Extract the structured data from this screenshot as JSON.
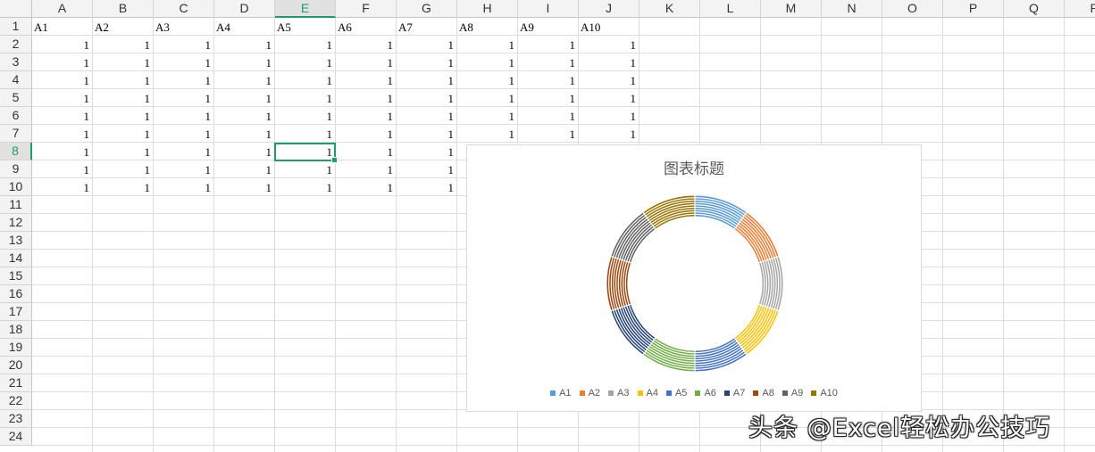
{
  "columns": [
    "A",
    "B",
    "C",
    "D",
    "E",
    "F",
    "G",
    "H",
    "I",
    "J",
    "K",
    "L",
    "M",
    "N",
    "O",
    "P",
    "Q",
    "R"
  ],
  "rows": [
    "1",
    "2",
    "3",
    "4",
    "5",
    "6",
    "7",
    "8",
    "9",
    "10",
    "11",
    "12",
    "13",
    "14",
    "15",
    "16",
    "17",
    "18",
    "19",
    "20",
    "21",
    "22",
    "23",
    "24"
  ],
  "selected_column": "E",
  "selected_row": "8",
  "header_row": [
    "A1",
    "A2",
    "A3",
    "A4",
    "A5",
    "A6",
    "A7",
    "A8",
    "A9",
    "A10"
  ],
  "cell_value": "1",
  "chart": {
    "title": "图表标题",
    "legend": [
      {
        "name": "A1",
        "color": "#5b9bd5"
      },
      {
        "name": "A2",
        "color": "#ed7d31"
      },
      {
        "name": "A3",
        "color": "#a5a5a5"
      },
      {
        "name": "A4",
        "color": "#ffc000"
      },
      {
        "name": "A5",
        "color": "#4472c4"
      },
      {
        "name": "A6",
        "color": "#70ad47"
      },
      {
        "name": "A7",
        "color": "#264478"
      },
      {
        "name": "A8",
        "color": "#9e480e"
      },
      {
        "name": "A9",
        "color": "#636363"
      },
      {
        "name": "A10",
        "color": "#997300"
      }
    ]
  },
  "chart_data": {
    "type": "doughnut",
    "title": "图表标题",
    "categories": [
      "A1",
      "A2",
      "A3",
      "A4",
      "A5",
      "A6",
      "A7",
      "A8",
      "A9",
      "A10"
    ],
    "series": [
      {
        "values": [
          1,
          1,
          1,
          1,
          1,
          1,
          1,
          1,
          1,
          1
        ]
      },
      {
        "values": [
          1,
          1,
          1,
          1,
          1,
          1,
          1,
          1,
          1,
          1
        ]
      },
      {
        "values": [
          1,
          1,
          1,
          1,
          1,
          1,
          1,
          1,
          1,
          1
        ]
      },
      {
        "values": [
          1,
          1,
          1,
          1,
          1,
          1,
          1,
          1,
          1,
          1
        ]
      },
      {
        "values": [
          1,
          1,
          1,
          1,
          1,
          1,
          1,
          1,
          1,
          1
        ]
      },
      {
        "values": [
          1,
          1,
          1,
          1,
          1,
          1,
          1,
          1,
          1,
          1
        ]
      },
      {
        "values": [
          1,
          1,
          1,
          1,
          1,
          1,
          1,
          1,
          1,
          1
        ]
      },
      {
        "values": [
          1,
          1,
          1,
          1,
          1,
          1,
          1,
          1,
          1,
          1
        ]
      },
      {
        "values": [
          1,
          1,
          1,
          1,
          1,
          1,
          1,
          1,
          1,
          1
        ]
      }
    ],
    "legend_position": "bottom"
  },
  "watermark": "头条 @Excel轻松办公技巧"
}
